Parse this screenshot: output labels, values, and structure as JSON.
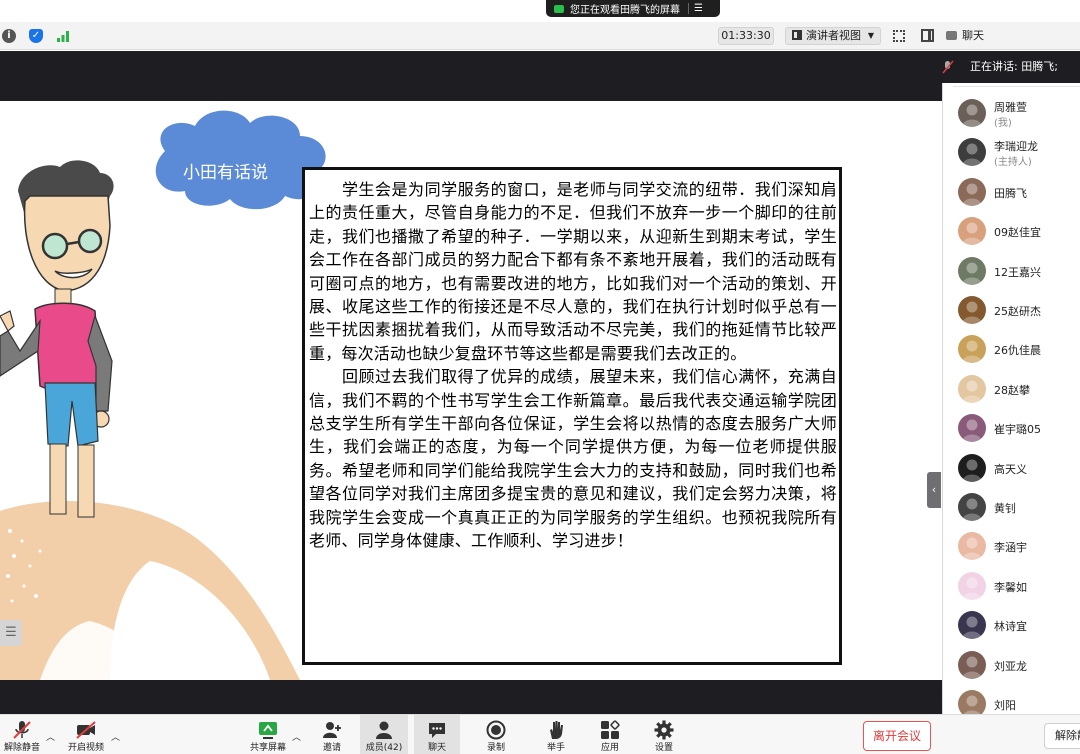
{
  "banner": {
    "text": "您正在观看田腾飞的屏幕",
    "menu_icon": "menu-icon"
  },
  "statusbar": {
    "timer": "01:33:30",
    "view_mode": "演讲者视图",
    "chat": "聊天",
    "icons": [
      "info-icon",
      "shield-icon",
      "signal-icon",
      "fullscreen-icon",
      "sidebar-icon",
      "chat-icon"
    ],
    "colors": {
      "info": "#555555",
      "shield": "#1a73e8",
      "signal": "#29b34a"
    }
  },
  "speaker": {
    "text": "正在讲话: 田腾飞;"
  },
  "participants": [
    {
      "name": "周雅萱",
      "role": "(我)",
      "avatar_color": "#6b6058"
    },
    {
      "name": "李瑞迎龙",
      "role": "(主持人)",
      "avatar_color": "#3d3d3d"
    },
    {
      "name": "田腾飞",
      "role": "",
      "avatar_color": "#8c6a5a"
    },
    {
      "name": "09赵佳宜",
      "role": "",
      "avatar_color": "#d9a07e"
    },
    {
      "name": "12王嘉兴",
      "role": "",
      "avatar_color": "#6e7a64"
    },
    {
      "name": "25赵研杰",
      "role": "",
      "avatar_color": "#84592f"
    },
    {
      "name": "26仇佳晨",
      "role": "",
      "avatar_color": "#c9a15a"
    },
    {
      "name": "28赵攀",
      "role": "",
      "avatar_color": "#e3c7a1"
    },
    {
      "name": "崔宇璐05",
      "role": "",
      "avatar_color": "#8a5a7a"
    },
    {
      "name": "高天义",
      "role": "",
      "avatar_color": "#1e1e1e"
    },
    {
      "name": "黄钊",
      "role": "",
      "avatar_color": "#444444"
    },
    {
      "name": "李涵宇",
      "role": "",
      "avatar_color": "#e9b9a4"
    },
    {
      "name": "李馨如",
      "role": "",
      "avatar_color": "#f2d3e6"
    },
    {
      "name": "林诗宜",
      "role": "",
      "avatar_color": "#3a3650"
    },
    {
      "name": "刘亚龙",
      "role": "",
      "avatar_color": "#7a5e55"
    },
    {
      "name": "刘阳",
      "role": "",
      "avatar_color": "#9a7a62"
    }
  ],
  "slide": {
    "bubble_text": "小田有话说",
    "paragraphs": [
      "　　学生会是为同学服务的窗口，是老师与同学交流的纽带．我们深知肩上的责任重大，尽管自身能力的不足．但我们不放弃一步一个脚印的往前走，我们也播撒了希望的种子．一学期以来，从迎新生到期末考试，学生会工作在各部门成员的努力配合下都有条不紊地开展着，我们的活动既有可圈可点的地方，也有需要改进的地方，比如我们对一个活动的策划、开展、收尾这些工作的衔接还是不尽人意的，我们在执行计划时似乎总有一些干扰因素捆扰着我们，从而导致活动不尽完美，我们的拖延情节比较严重，每次活动也缺少复盘环节等这些都是需要我们去改正的。",
      "　　回顾过去我们取得了优异的成绩，展望未来，我们信心满怀，充满自信，我们不羁的个性书写学生会工作新篇章。最后我代表交通运输学院团总支学生所有学生干部向各位保证，学生会将以热情的态度去服务广大师生，我们会端正的态度，为每一个同学提供方便，为每一位老师提供服务。希望老师和同学们能给我院学生会大力的支持和鼓励，同时我们也希望各位同学对我们主席团多提宝贵的意见和建议，我们定会努力决策，将我院学生会变成一个真真正正的为同学服务的学生组织。也预祝我院所有老师、同学身体健康、工作顺利、学习进步！"
    ],
    "colors": {
      "bubble": "#5b8bd6",
      "cream": "#f2cfa9"
    }
  },
  "toolbar": {
    "unmute": "解除静音",
    "start_video": "开启视频",
    "share": "共享屏幕",
    "invite": "邀请",
    "members": "成员(42)",
    "chat": "聊天",
    "record": "录制",
    "raise_hand": "举手",
    "apps": "应用",
    "settings": "设置",
    "leave": "离开会议",
    "unmute_all": "解除静音",
    "colors": {
      "leave": "#e23c3c",
      "share": "#29a745"
    }
  }
}
